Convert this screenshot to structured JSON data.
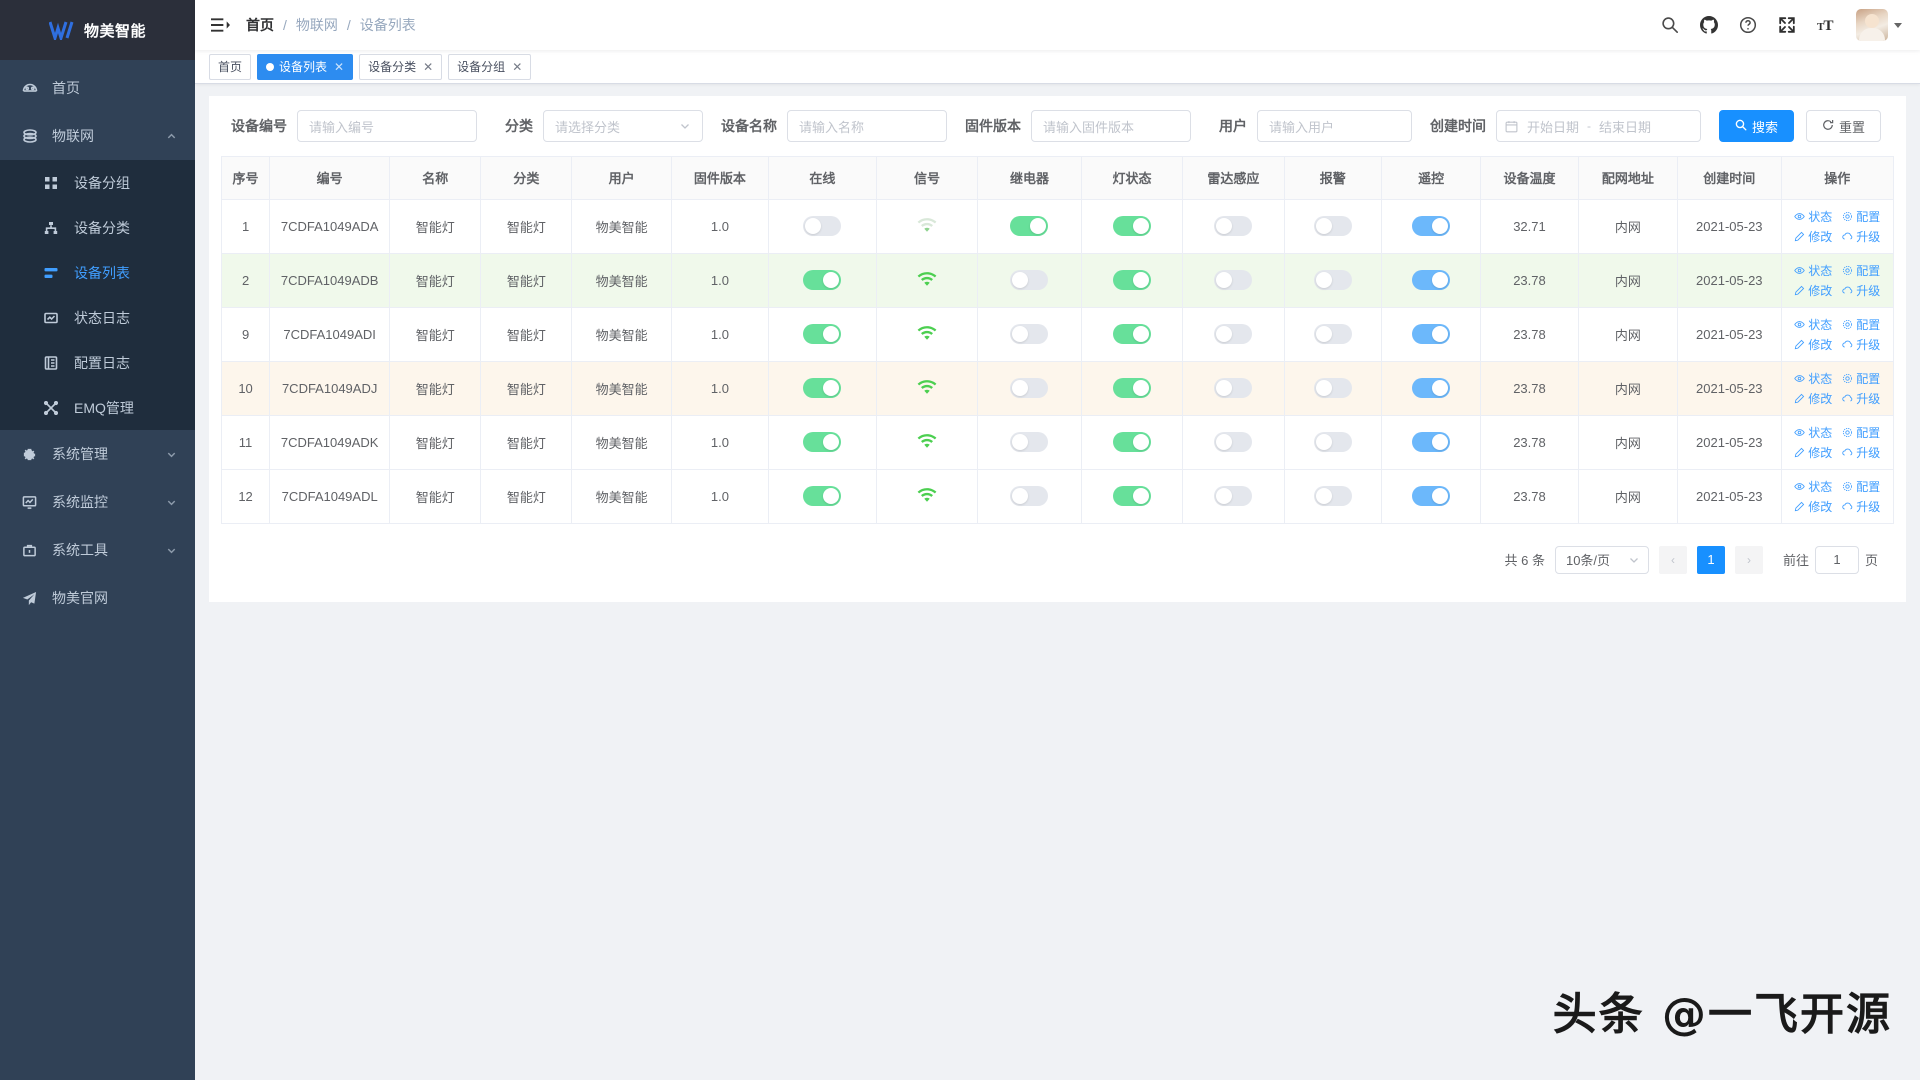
{
  "sidebar": {
    "logo_text": "物美智能",
    "items": [
      {
        "label": "首页",
        "icon": "dashboard-icon",
        "type": "single"
      },
      {
        "label": "物联网",
        "icon": "iot-icon",
        "type": "group",
        "expanded": true,
        "children": [
          {
            "label": "设备分组",
            "icon": "grid-icon",
            "active": false
          },
          {
            "label": "设备分类",
            "icon": "sitemap-icon",
            "active": false
          },
          {
            "label": "设备列表",
            "icon": "list-icon",
            "active": true
          },
          {
            "label": "状态日志",
            "icon": "chart-box-icon",
            "active": false
          },
          {
            "label": "配置日志",
            "icon": "book-icon",
            "active": false
          },
          {
            "label": "EMQ管理",
            "icon": "share-icon",
            "active": false
          }
        ]
      },
      {
        "label": "系统管理",
        "icon": "gear-icon",
        "type": "group",
        "expanded": false
      },
      {
        "label": "系统监控",
        "icon": "monitor-icon",
        "type": "group",
        "expanded": false
      },
      {
        "label": "系统工具",
        "icon": "toolbox-icon",
        "type": "group",
        "expanded": false
      },
      {
        "label": "物美官网",
        "icon": "send-icon",
        "type": "single"
      }
    ]
  },
  "navbar": {
    "hamburger_icon": "hamburger-icon",
    "breadcrumb": [
      "首页",
      "物联网",
      "设备列表"
    ],
    "separator": "/",
    "icons": [
      "search-icon",
      "github-icon",
      "help-icon",
      "fullscreen-icon",
      "font-size-icon"
    ],
    "avatar": "avatar",
    "caret": "chevron-down-icon"
  },
  "tabs": [
    {
      "label": "首页",
      "active": false,
      "closable": false
    },
    {
      "label": "设备列表",
      "active": true,
      "closable": true
    },
    {
      "label": "设备分类",
      "active": false,
      "closable": true
    },
    {
      "label": "设备分组",
      "active": false,
      "closable": true
    }
  ],
  "filters": {
    "device_no": {
      "label": "设备编号",
      "value": "",
      "placeholder": "请输入编号"
    },
    "category": {
      "label": "分类",
      "value": "",
      "placeholder": "请选择分类"
    },
    "device_name": {
      "label": "设备名称",
      "value": "",
      "placeholder": "请输入名称"
    },
    "firmware": {
      "label": "固件版本",
      "value": "",
      "placeholder": "请输入固件版本"
    },
    "user": {
      "label": "用户",
      "value": "",
      "placeholder": "请输入用户"
    },
    "created": {
      "label": "创建时间",
      "start_placeholder": "开始日期",
      "end_placeholder": "结束日期",
      "dash": "-"
    },
    "search_button": "搜索",
    "reset_button": "重置"
  },
  "table": {
    "columns": [
      "序号",
      "编号",
      "名称",
      "分类",
      "用户",
      "固件版本",
      "在线",
      "信号",
      "继电器",
      "灯状态",
      "雷达感应",
      "报警",
      "遥控",
      "设备温度",
      "配网地址",
      "创建时间",
      "操作"
    ],
    "ops_labels": [
      {
        "label": "状态",
        "icon": "eye-icon"
      },
      {
        "label": "配置",
        "icon": "gear-icon"
      },
      {
        "label": "修改",
        "icon": "edit-icon"
      },
      {
        "label": "升级",
        "icon": "cloud-upload-icon"
      }
    ],
    "rows": [
      {
        "seq": "1",
        "code": "7CDFA1049ADA",
        "name": "智能灯",
        "category": "智能灯",
        "user": "物美智能",
        "firmware": "1.0",
        "online": "off",
        "signal": "weak",
        "relay": "on-green",
        "light": "on-green",
        "radar": "off",
        "alarm": "off",
        "remote": "on-blue",
        "temp": "32.71",
        "net": "内网",
        "created": "2021-05-23",
        "highlight": "none"
      },
      {
        "seq": "2",
        "code": "7CDFA1049ADB",
        "name": "智能灯",
        "category": "智能灯",
        "user": "物美智能",
        "firmware": "1.0",
        "online": "on-green",
        "signal": "strong",
        "relay": "off",
        "light": "on-green",
        "radar": "off",
        "alarm": "off",
        "remote": "on-blue",
        "temp": "23.78",
        "net": "内网",
        "created": "2021-05-23",
        "highlight": "green"
      },
      {
        "seq": "9",
        "code": "7CDFA1049ADI",
        "name": "智能灯",
        "category": "智能灯",
        "user": "物美智能",
        "firmware": "1.0",
        "online": "on-green",
        "signal": "strong",
        "relay": "off",
        "light": "on-green",
        "radar": "off",
        "alarm": "off",
        "remote": "on-blue",
        "temp": "23.78",
        "net": "内网",
        "created": "2021-05-23",
        "highlight": "none"
      },
      {
        "seq": "10",
        "code": "7CDFA1049ADJ",
        "name": "智能灯",
        "category": "智能灯",
        "user": "物美智能",
        "firmware": "1.0",
        "online": "on-green",
        "signal": "strong",
        "relay": "off",
        "light": "on-green",
        "radar": "off",
        "alarm": "off",
        "remote": "on-blue",
        "temp": "23.78",
        "net": "内网",
        "created": "2021-05-23",
        "highlight": "orange"
      },
      {
        "seq": "11",
        "code": "7CDFA1049ADK",
        "name": "智能灯",
        "category": "智能灯",
        "user": "物美智能",
        "firmware": "1.0",
        "online": "on-green",
        "signal": "strong",
        "relay": "off",
        "light": "on-green",
        "radar": "off",
        "alarm": "off",
        "remote": "on-blue",
        "temp": "23.78",
        "net": "内网",
        "created": "2021-05-23",
        "highlight": "none"
      },
      {
        "seq": "12",
        "code": "7CDFA1049ADL",
        "name": "智能灯",
        "category": "智能灯",
        "user": "物美智能",
        "firmware": "1.0",
        "online": "on-green",
        "signal": "strong",
        "relay": "off",
        "light": "on-green",
        "radar": "off",
        "alarm": "off",
        "remote": "on-blue",
        "temp": "23.78",
        "net": "内网",
        "created": "2021-05-23",
        "highlight": "none"
      }
    ]
  },
  "pagination": {
    "total_text": "共 6 条",
    "page_size": "10条/页",
    "prev": "‹",
    "current_page": "1",
    "next": "›",
    "jump_label": "前往",
    "jump_value": "1",
    "jump_unit": "页"
  },
  "watermark": "头条 @一飞开源",
  "colors": {
    "sidebar_bg": "#304156",
    "submenu_bg": "#1f2d3d",
    "accent_blue": "#409EFF",
    "primary_button": "#1890ff",
    "switch_green": "#67e09a",
    "switch_blue": "#6cb8fb",
    "switch_off": "#e4e7ed",
    "row_green": "#f0f9eb",
    "row_orange": "#fdf6ec",
    "signal_green": "#4ccf50"
  }
}
